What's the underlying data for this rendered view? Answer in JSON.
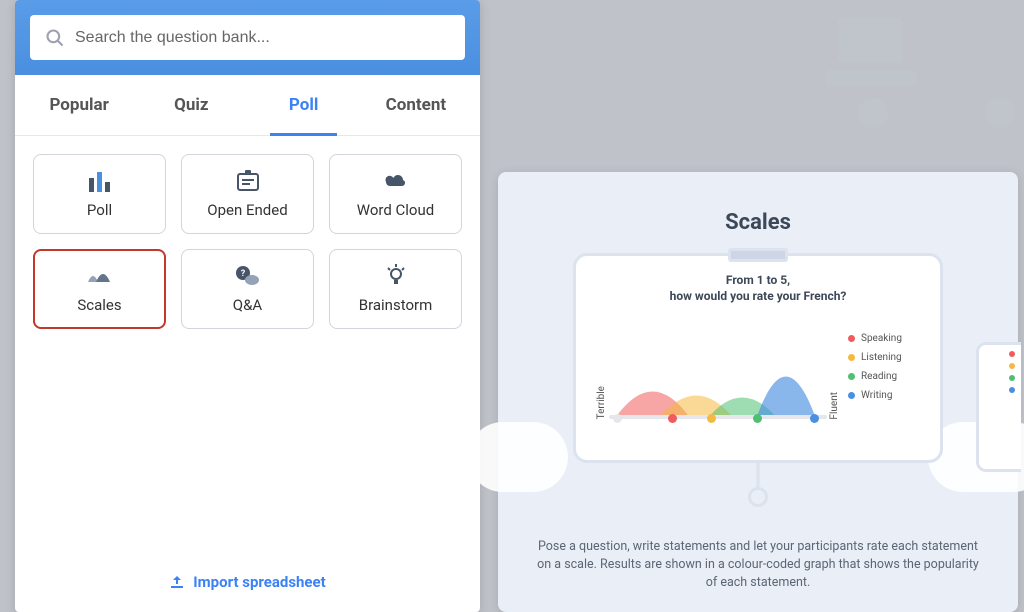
{
  "search": {
    "placeholder": "Search the question bank..."
  },
  "tabs": {
    "popular": "Popular",
    "quiz": "Quiz",
    "poll": "Poll",
    "content": "Content"
  },
  "cards": {
    "poll": "Poll",
    "open_ended": "Open Ended",
    "word_cloud": "Word Cloud",
    "scales": "Scales",
    "qa": "Q&A",
    "brainstorm": "Brainstorm"
  },
  "import_label": "Import spreadsheet",
  "preview": {
    "heading": "Scales",
    "chart_title_1": "From 1 to 5,",
    "chart_title_2": "how would you rate your French?",
    "low_label": "Terrible",
    "high_label": "Fluent",
    "legend": {
      "speaking": "Speaking",
      "listening": "Listening",
      "reading": "Reading",
      "writing": "Writing"
    },
    "description": "Pose a question, write statements and let your participants rate each statement on a scale. Results are shown in a colour-coded graph that shows the popularity of each statement."
  },
  "colors": {
    "speaking": "#f15b5b",
    "listening": "#f5b942",
    "reading": "#4fbf71",
    "writing": "#4a8fe0"
  },
  "chart_data": {
    "type": "area",
    "title": "From 1 to 5, how would you rate your French?",
    "xlabel_low": "Terrible",
    "xlabel_high": "Fluent",
    "xlim": [
      1,
      5
    ],
    "series": [
      {
        "name": "Speaking",
        "peak_x": 1.8,
        "peak_height": 50,
        "color": "#f15b5b"
      },
      {
        "name": "Listening",
        "peak_x": 2.6,
        "peak_height": 43,
        "color": "#f5b942"
      },
      {
        "name": "Reading",
        "peak_x": 3.4,
        "peak_height": 40,
        "color": "#4fbf71"
      },
      {
        "name": "Writing",
        "peak_x": 4.2,
        "peak_height": 75,
        "color": "#4a8fe0"
      }
    ]
  }
}
